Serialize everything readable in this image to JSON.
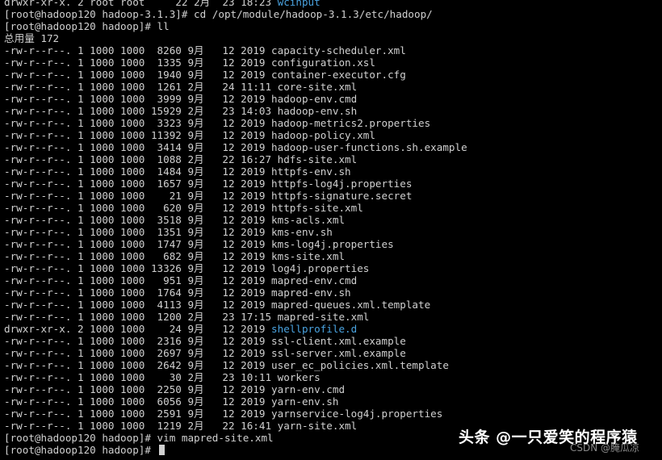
{
  "terminal": {
    "lines": [
      {
        "text": "drwxr-xr-x. 2 root root     22 2月  23 18:23 ",
        "link": "wcinput"
      },
      {
        "text": "[root@hadoop120 hadoop-3.1.3]# cd /opt/module/hadoop-3.1.3/etc/hadoop/"
      },
      {
        "text": "[root@hadoop120 hadoop]# ll"
      },
      {
        "text": "总用量 172"
      },
      {
        "text": "-rw-r--r--. 1 1000 1000  8260 9月   12 2019 capacity-scheduler.xml"
      },
      {
        "text": "-rw-r--r--. 1 1000 1000  1335 9月   12 2019 configuration.xsl"
      },
      {
        "text": "-rw-r--r--. 1 1000 1000  1940 9月   12 2019 container-executor.cfg"
      },
      {
        "text": "-rw-r--r--. 1 1000 1000  1261 2月   24 11:11 core-site.xml"
      },
      {
        "text": "-rw-r--r--. 1 1000 1000  3999 9月   12 2019 hadoop-env.cmd"
      },
      {
        "text": "-rw-r--r--. 1 1000 1000 15929 2月   23 14:03 hadoop-env.sh"
      },
      {
        "text": "-rw-r--r--. 1 1000 1000  3323 9月   12 2019 hadoop-metrics2.properties"
      },
      {
        "text": "-rw-r--r--. 1 1000 1000 11392 9月   12 2019 hadoop-policy.xml"
      },
      {
        "text": "-rw-r--r--. 1 1000 1000  3414 9月   12 2019 hadoop-user-functions.sh.example"
      },
      {
        "text": "-rw-r--r--. 1 1000 1000  1088 2月   22 16:27 hdfs-site.xml"
      },
      {
        "text": "-rw-r--r--. 1 1000 1000  1484 9月   12 2019 httpfs-env.sh"
      },
      {
        "text": "-rw-r--r--. 1 1000 1000  1657 9月   12 2019 httpfs-log4j.properties"
      },
      {
        "text": "-rw-r--r--. 1 1000 1000    21 9月   12 2019 httpfs-signature.secret"
      },
      {
        "text": "-rw-r--r--. 1 1000 1000   620 9月   12 2019 httpfs-site.xml"
      },
      {
        "text": "-rw-r--r--. 1 1000 1000  3518 9月   12 2019 kms-acls.xml"
      },
      {
        "text": "-rw-r--r--. 1 1000 1000  1351 9月   12 2019 kms-env.sh"
      },
      {
        "text": "-rw-r--r--. 1 1000 1000  1747 9月   12 2019 kms-log4j.properties"
      },
      {
        "text": "-rw-r--r--. 1 1000 1000   682 9月   12 2019 kms-site.xml"
      },
      {
        "text": "-rw-r--r--. 1 1000 1000 13326 9月   12 2019 log4j.properties"
      },
      {
        "text": "-rw-r--r--. 1 1000 1000   951 9月   12 2019 mapred-env.cmd"
      },
      {
        "text": "-rw-r--r--. 1 1000 1000  1764 9月   12 2019 mapred-env.sh"
      },
      {
        "text": "-rw-r--r--. 1 1000 1000  4113 9月   12 2019 mapred-queues.xml.template"
      },
      {
        "text": "-rw-r--r--. 1 1000 1000  1200 2月   23 17:15 mapred-site.xml"
      },
      {
        "text": "drwxr-xr-x. 2 1000 1000    24 9月   12 2019 ",
        "link": "shellprofile.d"
      },
      {
        "text": "-rw-r--r--. 1 1000 1000  2316 9月   12 2019 ssl-client.xml.example"
      },
      {
        "text": "-rw-r--r--. 1 1000 1000  2697 9月   12 2019 ssl-server.xml.example"
      },
      {
        "text": "-rw-r--r--. 1 1000 1000  2642 9月   12 2019 user_ec_policies.xml.template"
      },
      {
        "text": "-rw-r--r--. 1 1000 1000    30 2月   23 10:11 workers"
      },
      {
        "text": "-rw-r--r--. 1 1000 1000  2250 9月   12 2019 yarn-env.cmd"
      },
      {
        "text": "-rw-r--r--. 1 1000 1000  6056 9月   12 2019 yarn-env.sh"
      },
      {
        "text": "-rw-r--r--. 1 1000 1000  2591 9月   12 2019 yarnservice-log4j.properties"
      },
      {
        "text": "-rw-r--r--. 1 1000 1000  1219 2月   22 16:41 yarn-site.xml"
      },
      {
        "text": "[root@hadoop120 hadoop]# vim mapred-site.xml"
      }
    ],
    "prompt": "[root@hadoop120 hadoop]# ",
    "colors": {
      "background": "#000000",
      "foreground": "#d0d0d0",
      "directory": "#4aa3e0"
    }
  },
  "watermark": {
    "toutiao": "头条 @一只爱笑的程序猿",
    "csdn": "CSDN @腌瓜凉"
  }
}
